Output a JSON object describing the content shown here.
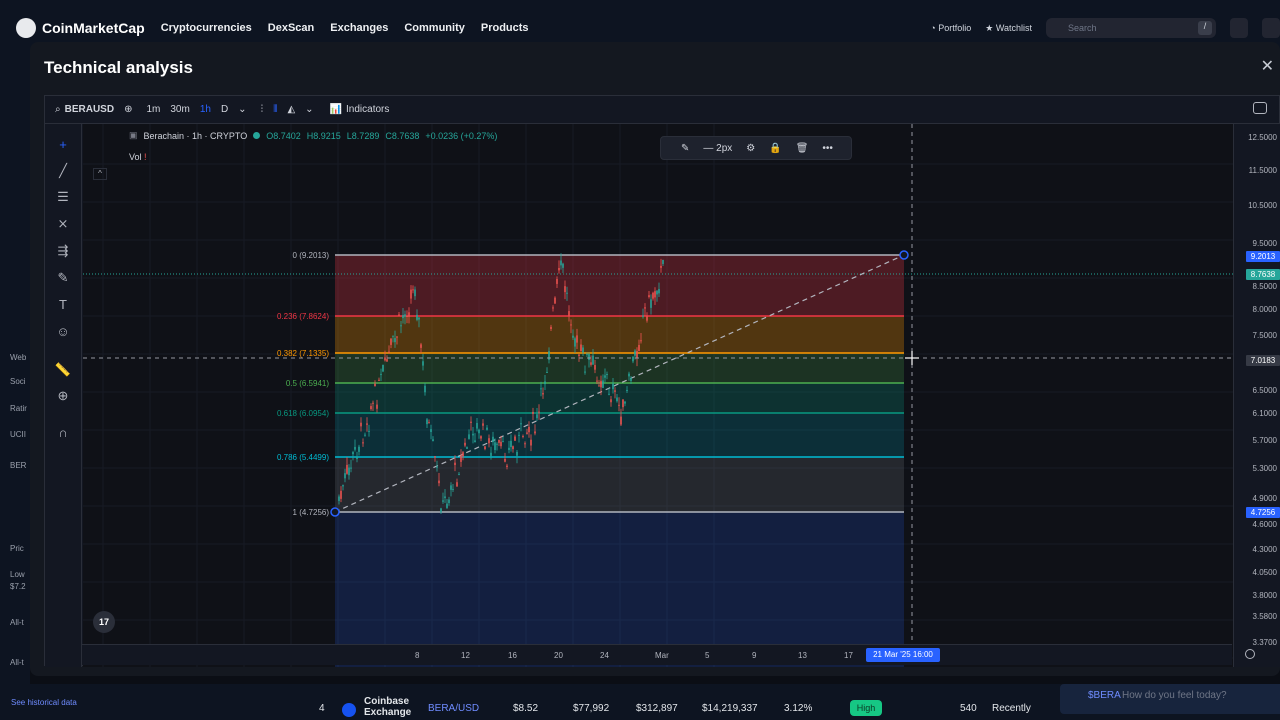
{
  "site": {
    "logo_text": "CoinMarketCap",
    "nav": [
      "Cryptocurrencies",
      "DexScan",
      "Exchanges",
      "Community",
      "Products"
    ],
    "portfolio": "Portfolio",
    "watchlist": "Watchlist",
    "search_placeholder": "Search",
    "search_shortcut": "/"
  },
  "modal": {
    "title": "Technical analysis"
  },
  "toolbar": {
    "symbol": "BERAUSD",
    "intervals": [
      "1m",
      "30m",
      "1h",
      "D"
    ],
    "active_interval": "1h",
    "indicators": "Indicators"
  },
  "legend": {
    "name": "Berachain · 1h · CRYPTO",
    "o": "O8.7402",
    "h": "H8.9215",
    "l": "L8.7289",
    "c": "C8.7638",
    "change": "+0.0236 (+0.27%)",
    "vol": "Vol"
  },
  "drawing_toolbar": {
    "width_label": "2px"
  },
  "fib_levels": [
    {
      "label": "0 (9.2013)",
      "color": "#b2b5be"
    },
    {
      "label": "0.236 (7.8624)",
      "color": "#f23645"
    },
    {
      "label": "0.382 (7.1335)",
      "color": "#ff9800"
    },
    {
      "label": "0.5 (6.5941)",
      "color": "#4caf50"
    },
    {
      "label": "0.618 (6.0954)",
      "color": "#089981"
    },
    {
      "label": "0.786 (5.4499)",
      "color": "#00bcd4"
    },
    {
      "label": "1 (4.7256)",
      "color": "#b2b5be"
    }
  ],
  "price_ticks": [
    "12.5000",
    "11.5000",
    "10.5000",
    "9.5000",
    "8.5000",
    "8.0000",
    "7.5000",
    "6.5000",
    "6.1000",
    "5.7000",
    "5.3000",
    "4.9000",
    "4.6000",
    "4.3000",
    "4.0500",
    "3.8000",
    "3.5800",
    "3.3700"
  ],
  "price_badges": {
    "fib_top": "9.2013",
    "last": "8.7638",
    "crosshair": "7.0183",
    "fib_bottom": "4.7256"
  },
  "time_ticks": [
    "8",
    "12",
    "16",
    "20",
    "24",
    "Mar",
    "5",
    "9",
    "13",
    "17"
  ],
  "crosshair_time": "21 Mar '25  16:00",
  "bottom_row": {
    "rank": "4",
    "exchange": "Coinbase Exchange",
    "pair": "BERA/USD",
    "price": "$8.52",
    "depth_plus": "$77,992",
    "depth_minus": "$312,897",
    "volume": "$14,219,337",
    "volume_pct": "3.12%",
    "confidence": "High",
    "liquidity": "540",
    "updated": "Recently",
    "historical_link": "See historical data",
    "ticker_chip": "$BERA",
    "chip_prompt": "How do you feel today?"
  },
  "left_bg_labels": [
    "Web",
    "Soci",
    "Ratir",
    "UCII",
    "BER",
    "Pric",
    "Low",
    "$7.2",
    "All-t",
    "All-t"
  ],
  "colors": {
    "accent": "#2962ff",
    "up": "#26a69a",
    "down": "#ef5350",
    "brand": "#3861fb"
  }
}
